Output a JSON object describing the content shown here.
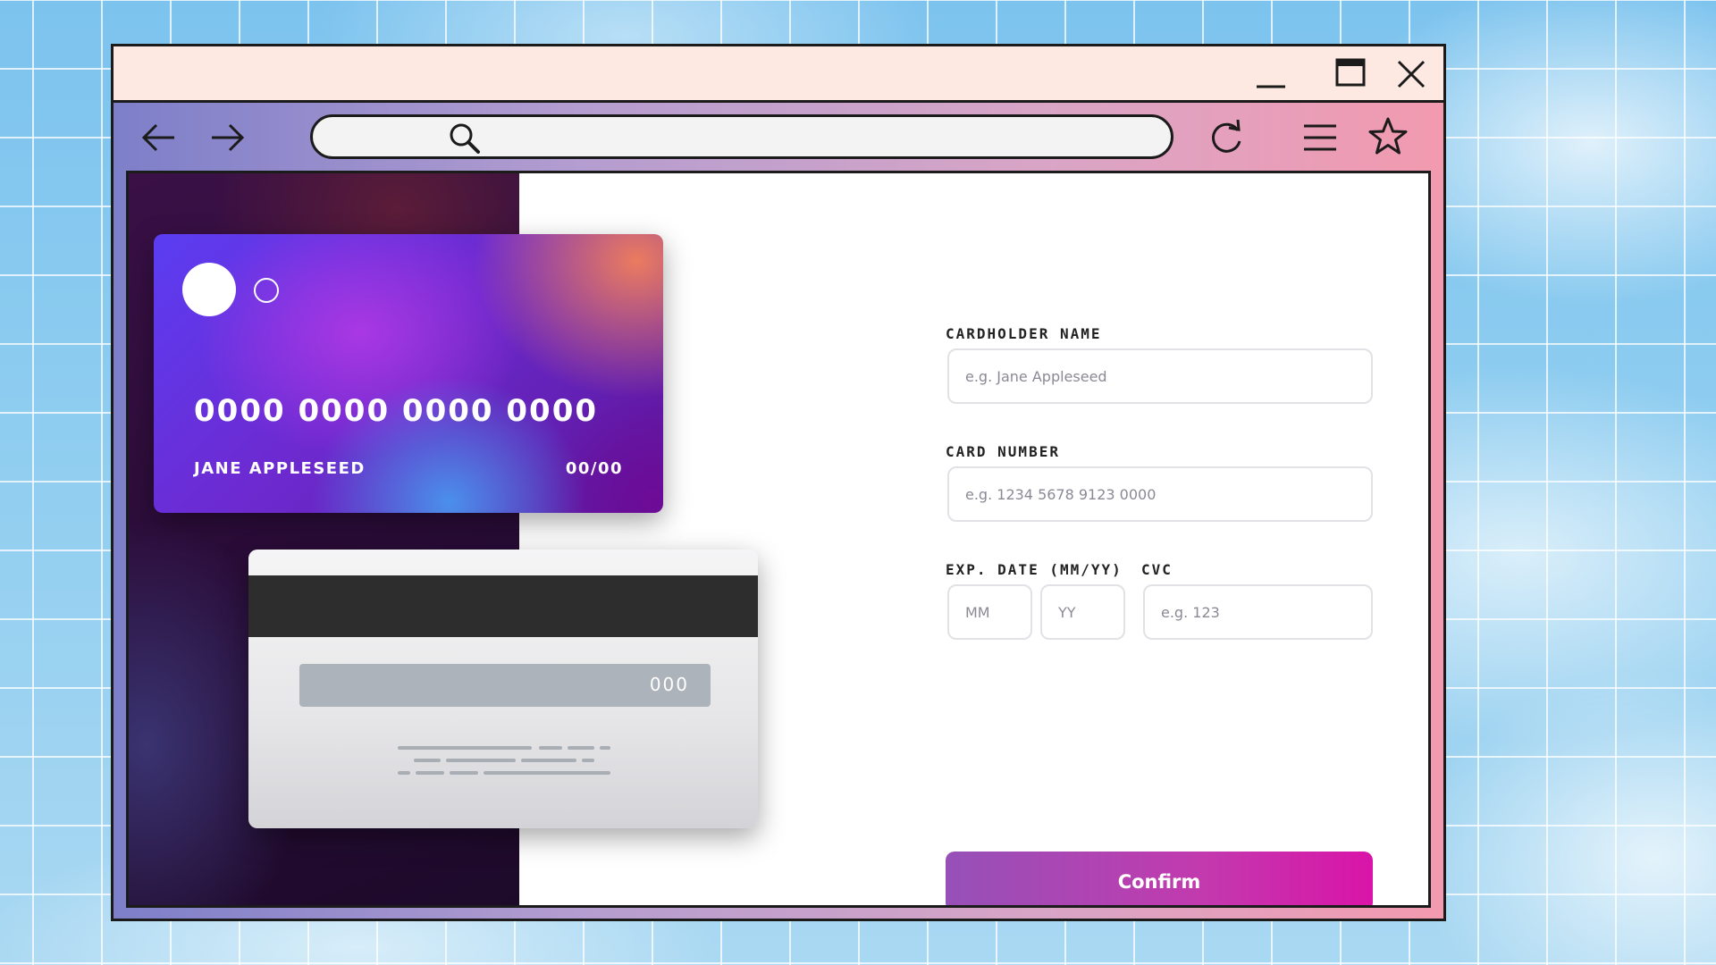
{
  "window": {
    "controls": [
      "minimize-icon",
      "maximize-icon",
      "close-icon"
    ]
  },
  "nav": {
    "icons": [
      "arrow-left-icon",
      "arrow-right-icon",
      "search-icon",
      "refresh-icon",
      "hamburger-menu-icon",
      "star-icon"
    ],
    "address_value": ""
  },
  "card_front": {
    "number": "0000 0000 0000 0000",
    "name": "JANE APPLESEED",
    "expiry": "00/00"
  },
  "card_back": {
    "cvc": "000"
  },
  "form": {
    "cardholder_label": "CARDHOLDER NAME",
    "cardholder_placeholder": "e.g. Jane Appleseed",
    "number_label": "CARD NUMBER",
    "number_placeholder": "e.g. 1234 5678 9123 0000",
    "exp_label": "EXP. DATE (MM/YY)",
    "mm_placeholder": "MM",
    "yy_placeholder": "YY",
    "cvc_label": "CVC",
    "cvc_placeholder": "e.g. 123",
    "confirm_label": "Confirm"
  },
  "colors": {
    "button_gradient_start": "#9651b8",
    "button_gradient_end": "#d914a8",
    "titlebar": "#fde9e2",
    "toolbar_gradient_start": "#7d7fc9",
    "toolbar_gradient_end": "#f29aaf"
  }
}
